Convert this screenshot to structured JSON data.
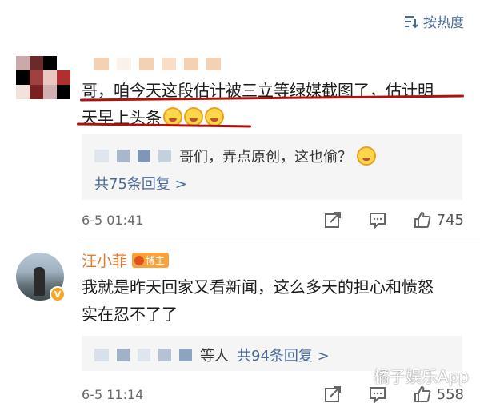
{
  "sort": {
    "label": "按热度"
  },
  "comment1": {
    "text_line1": "哥，咱今天这段估计被三立等绿媒截图了，估计明",
    "text_line2": "天早上头条",
    "reply": {
      "text": "哥们，弄点原创，这也偷？",
      "more": "共75条回复 >"
    },
    "time": "6-5 01:41",
    "likes": "745"
  },
  "comment2": {
    "username": "汪小菲",
    "badge": "博主",
    "text_line1": "我就是昨天回家又看新闻，这么多天的担心和愤怒",
    "text_line2": "实在忍不了了",
    "reply": {
      "suffix": "等人",
      "more": "共94条回复 >"
    },
    "time": "6-5 11:14",
    "likes": "558"
  },
  "watermark": "橘子娱乐App",
  "colors": {
    "link": "#4a6a96",
    "username": "#e8792b",
    "underline": "#b01010"
  }
}
